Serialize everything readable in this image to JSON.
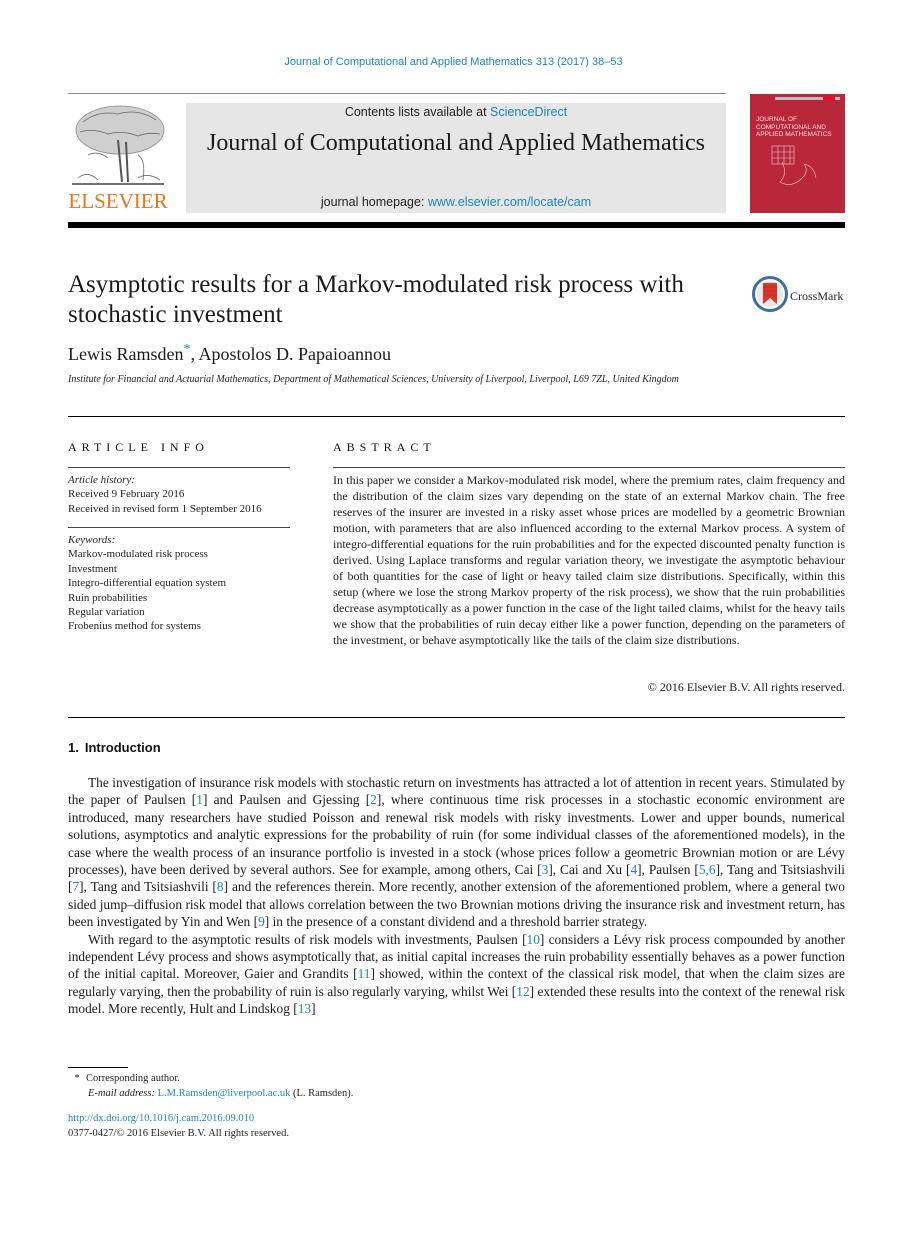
{
  "header": {
    "journal_reference": "Journal of Computational and Applied Mathematics 313 (2017) 38–53",
    "publisher_logo_text": "ELSEVIER",
    "contents_prefix": "Contents lists available at ",
    "contents_link": "ScienceDirect",
    "journal_title": "Journal of Computational and Applied Mathematics",
    "homepage_prefix": "journal homepage: ",
    "homepage_link": "www.elsevier.com/locate/cam",
    "cover_title": "JOURNAL OF COMPUTATIONAL AND APPLIED MATHEMATICS",
    "cover_color": "#b8283a",
    "logo_color": "#e8741d",
    "link_color": "#1a87b8"
  },
  "article": {
    "title": "Asymptotic results for a Markov-modulated risk process with stochastic investment",
    "crossmark_label": "CrossMark",
    "authors": [
      {
        "name": "Lewis Ramsden",
        "marker": "*"
      },
      {
        "name": "Apostolos D. Papaioannou",
        "marker": ""
      }
    ],
    "author_separator": ", ",
    "affiliation": "Institute for Financial and Actuarial Mathematics, Department of Mathematical Sciences, University of Liverpool, Liverpool, L69 7ZL, United Kingdom"
  },
  "article_info": {
    "heading": "ARTICLE INFO",
    "history_label": "Article history:",
    "history": [
      "Received 9 February 2016",
      "Received in revised form 1 September 2016"
    ],
    "keywords_label": "Keywords:",
    "keywords": [
      "Markov-modulated risk process",
      "Investment",
      "Integro-differential equation system",
      "Ruin probabilities",
      "Regular variation",
      "Frobenius method for systems"
    ]
  },
  "abstract": {
    "heading": "ABSTRACT",
    "text": "In this paper we consider a Markov-modulated risk model, where the premium rates, claim frequency and the distribution of the claim sizes vary depending on the state of an external Markov chain. The free reserves of the insurer are invested in a risky asset whose prices are modelled by a geometric Brownian motion, with parameters that are also influenced according to the external Markov process. A system of integro-differential equations for the ruin probabilities and for the expected discounted penalty function is derived. Using Laplace transforms and regular variation theory, we investigate the asymptotic behaviour of both quantities for the case of light or heavy tailed claim size distributions. Specifically, within this setup (where we lose the strong Markov property of the risk process), we show that the ruin probabilities decrease asymptotically as a power function in the case of the light tailed claims, whilst for the heavy tails we show that the probabilities of ruin decay either like a power function, depending on the parameters of the investment, or behave asymptotically like the tails of the claim size distributions.",
    "copyright": "© 2016 Elsevier B.V. All rights reserved."
  },
  "introduction": {
    "number": "1.",
    "title": "Introduction",
    "paragraphs": [
      [
        {
          "t": "The investigation of insurance risk models with stochastic return on investments has attracted a lot of attention in recent years. Stimulated by the paper of Paulsen ["
        },
        {
          "ref": "1"
        },
        {
          "t": "] and Paulsen and Gjessing ["
        },
        {
          "ref": "2"
        },
        {
          "t": "], where continuous time risk processes in a stochastic economic environment are introduced, many researchers have studied Poisson and renewal risk models with risky investments. Lower and upper bounds, numerical solutions, asymptotics and analytic expressions for the probability of ruin (for some individual classes of the aforementioned models), in the case where the wealth process of an insurance portfolio is invested in a stock (whose prices follow a geometric Brownian motion or are Lévy processes), have been derived by several authors. See for example, among others, Cai ["
        },
        {
          "ref": "3"
        },
        {
          "t": "], Cai and Xu ["
        },
        {
          "ref": "4"
        },
        {
          "t": "], Paulsen ["
        },
        {
          "ref": "5,6"
        },
        {
          "t": "], Tang and Tsitsiashvili ["
        },
        {
          "ref": "7"
        },
        {
          "t": "], Tang and Tsitsiashvili ["
        },
        {
          "ref": "8"
        },
        {
          "t": "] and the references therein. More recently, another extension of the aforementioned problem, where a general two sided jump–diffusion risk model that allows correlation between the two Brownian motions driving the insurance risk and investment return, has been investigated by Yin and Wen ["
        },
        {
          "ref": "9"
        },
        {
          "t": "] in the presence of a constant dividend and a threshold barrier strategy."
        }
      ],
      [
        {
          "t": "With regard to the asymptotic results of risk models with investments, Paulsen ["
        },
        {
          "ref": "10"
        },
        {
          "t": "] considers a Lévy risk process compounded by another independent Lévy process and shows asymptotically that, as initial capital increases the ruin probability essentially behaves as a power function of the initial capital. Moreover, Gaier and Grandits ["
        },
        {
          "ref": "11"
        },
        {
          "t": "] showed, within the context of the classical risk model, that when the claim sizes are regularly varying, then the probability of ruin is also regularly varying, whilst Wei ["
        },
        {
          "ref": "12"
        },
        {
          "t": "] extended these results into the context of the renewal risk model. More recently, Hult and Lindskog ["
        },
        {
          "ref": "13"
        },
        {
          "t": "]"
        }
      ]
    ]
  },
  "footnotes": {
    "marker": "*",
    "corresponding": "Corresponding author.",
    "email_label": "E-mail address:",
    "email": "L.M.Ramsden@liverpool.ac.uk",
    "email_suffix": " (L. Ramsden).",
    "doi": "http://dx.doi.org/10.1016/j.cam.2016.09.010",
    "issn_copyright": "0377-0427/© 2016 Elsevier B.V. All rights reserved."
  }
}
